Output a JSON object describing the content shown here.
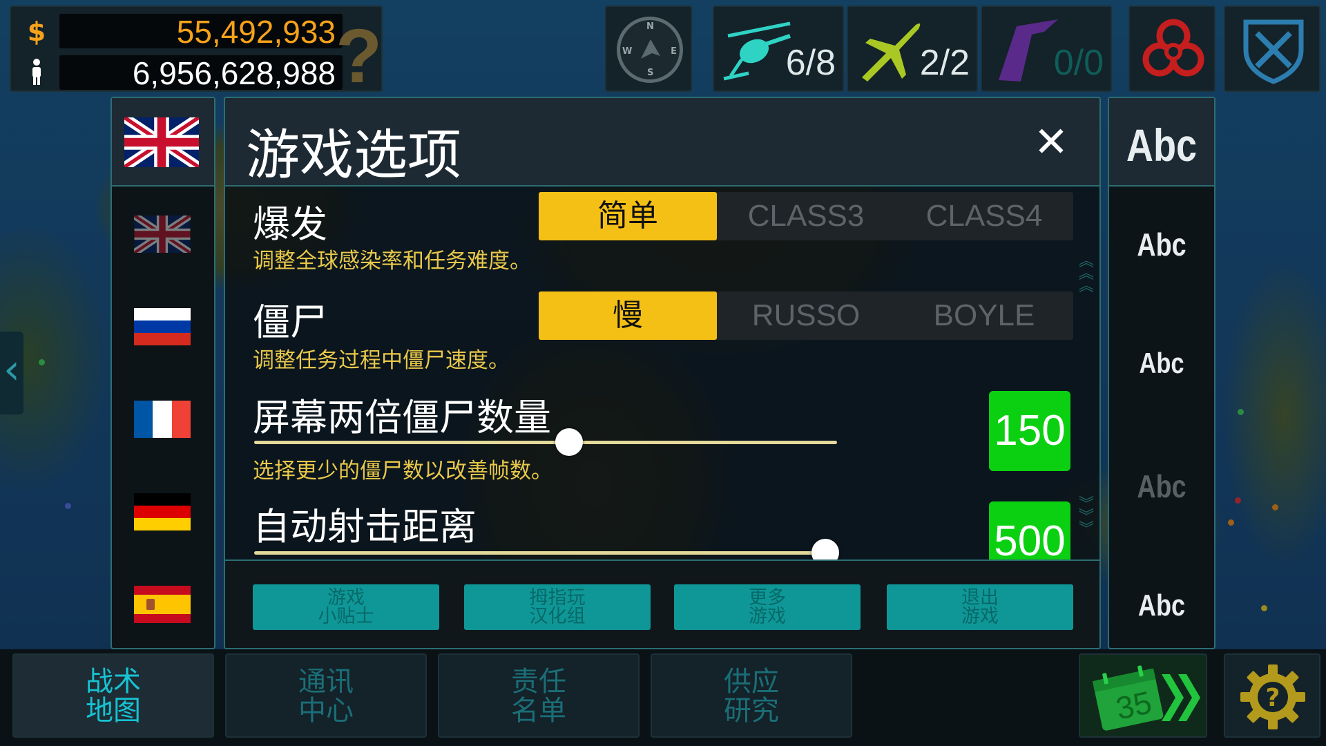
{
  "hud": {
    "money": "55,492,933",
    "money_symbol": "$",
    "population": "6,956,628,988",
    "help_mark": "?",
    "compass": {
      "n": "N",
      "s": "S",
      "e": "E",
      "w": "W"
    },
    "units": [
      {
        "name": "helicopter-icon",
        "count": "6/8",
        "color": "#2fd3c4"
      },
      {
        "name": "plane-icon",
        "count": "2/2",
        "color": "#a9c824"
      },
      {
        "name": "stealth-bomber-icon",
        "count": "0/0",
        "color": "#5a2a8a"
      }
    ],
    "biohazard_color": "#c41e1e",
    "shield_color": "#2c7db0"
  },
  "languages": {
    "selected": "uk",
    "flags": [
      "uk",
      "russia",
      "france",
      "germany",
      "spain"
    ]
  },
  "fonts": {
    "header_sample": "Abc",
    "samples": [
      "Abc",
      "Abc",
      "Abc",
      "Abc"
    ]
  },
  "dialog": {
    "title": "游戏选项",
    "close_symbol": "✕",
    "outbreak": {
      "label": "爆发",
      "description": "调整全球感染率和任务难度。",
      "options": [
        "简单",
        "CLASS3",
        "CLASS4"
      ],
      "selected": 0
    },
    "zombies": {
      "label": "僵尸",
      "description": "调整任务过程中僵尸速度。",
      "options": [
        "慢",
        "RUSSO",
        "BOYLE"
      ],
      "selected": 0
    },
    "zombie_count": {
      "label": "屏幕两倍僵尸数量",
      "description": "选择更少的僵尸数以改善帧数。",
      "value": "150",
      "slider_fraction": 0.54
    },
    "auto_fire_range": {
      "label": "自动射击距离",
      "value": "500",
      "slider_fraction": 0.98
    },
    "footer_buttons": [
      {
        "line1": "游戏",
        "line2": "小贴士"
      },
      {
        "line1": "拇指玩",
        "line2": "汉化组"
      },
      {
        "line1": "更多",
        "line2": "游戏"
      },
      {
        "line1": "退出",
        "line2": "游戏"
      }
    ]
  },
  "bottom_tabs": [
    {
      "line1": "战术",
      "line2": "地图",
      "active": true
    },
    {
      "line1": "通讯",
      "line2": "中心",
      "active": false
    },
    {
      "line1": "责任",
      "line2": "名单",
      "active": false
    },
    {
      "line1": "供应",
      "line2": "研究",
      "active": false
    }
  ],
  "next_day": "35",
  "colors": {
    "accent_yellow": "#f5c016",
    "value_green": "#0bd012",
    "teal_button": "#0f9797",
    "panel_border": "#2c6e74"
  }
}
